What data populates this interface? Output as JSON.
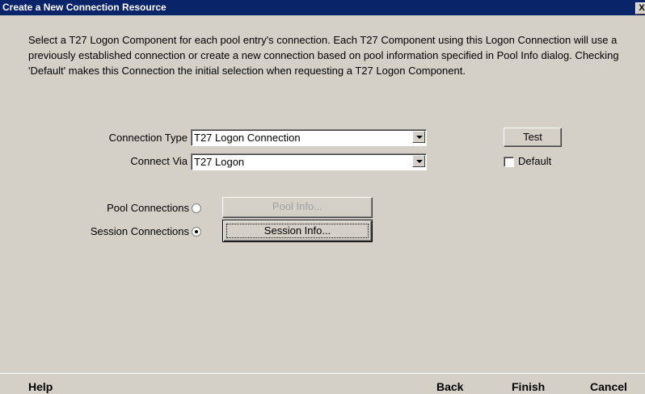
{
  "window": {
    "title": "Create a New Connection Resource",
    "close_glyph": "X"
  },
  "description": "Select a T27 Logon Component for each pool entry's connection. Each T27 Component using this Logon Connection will use a previously established connection or create a new connection based on pool information specified in Pool Info dialog. Checking 'Default' makes this Connection the initial selection when requesting a T27 Logon Component.",
  "form": {
    "connection_type": {
      "label": "Connection Type",
      "value": "T27 Logon Connection"
    },
    "connect_via": {
      "label": "Connect Via",
      "value": "T27 Logon"
    },
    "test_button": "Test",
    "default_checkbox": {
      "label": "Default",
      "checked": false
    },
    "pool_connections": {
      "label": "Pool Connections",
      "selected": false,
      "button": "Pool Info...",
      "button_enabled": false
    },
    "session_connections": {
      "label": "Session Connections",
      "selected": true,
      "button": "Session Info...",
      "button_enabled": true
    }
  },
  "footer": {
    "help": "Help",
    "back": "Back",
    "finish": "Finish",
    "cancel": "Cancel"
  },
  "colors": {
    "titlebar": "#0a246a",
    "dialog_bg": "#d4d0c8"
  }
}
